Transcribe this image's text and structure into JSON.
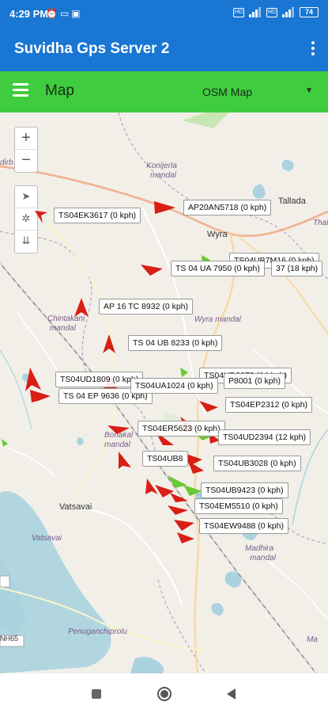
{
  "status": {
    "time": "4:29 PM",
    "left_icons": [
      "alarm-icon",
      "laptop-icon",
      "app-icon"
    ],
    "battery": "74",
    "hd1": "HD",
    "hd2": "HD"
  },
  "appbar": {
    "title": "Suvidha Gps Server 2",
    "menu_icon": "more-vert-icon"
  },
  "toolbar": {
    "label": "Map",
    "map_type": "OSM Map"
  },
  "map": {
    "zoom_in": "+",
    "zoom_out": "−",
    "places": [
      {
        "text": "Konijerla",
        "cls": "maplbl"
      },
      {
        "text": "mandal",
        "cls": "maplbl"
      },
      {
        "text": "Wyra",
        "cls": "townlbl"
      },
      {
        "text": "Wyra mandal",
        "cls": "maplbl"
      },
      {
        "text": "Chintakani",
        "cls": "maplbl"
      },
      {
        "text": "mandal",
        "cls": "maplbl"
      },
      {
        "text": "Bonakal",
        "cls": "maplbl"
      },
      {
        "text": "mandal",
        "cls": "maplbl"
      },
      {
        "text": "Vatsavai",
        "cls": "townlbl"
      },
      {
        "text": "Vatsavai",
        "cls": "maplbl"
      },
      {
        "text": "Madhira",
        "cls": "maplbl"
      },
      {
        "text": "mandal",
        "cls": "maplbl"
      },
      {
        "text": "Penuganchiprolu",
        "cls": "maplbl"
      },
      {
        "text": "Tallada",
        "cls": "townlbl"
      },
      {
        "text": "Thal",
        "cls": "maplbl"
      },
      {
        "text": "NH65",
        "cls": "townlbl"
      },
      {
        "text": "Ma",
        "cls": "maplbl"
      },
      {
        "text": "dirb",
        "cls": "maplbl"
      }
    ],
    "vehicles": [
      "AP20AN5718 (0 kph)",
      "TS04EK3617 (0 kph)",
      "TS04UB7M16 (0 kph)",
      "TS 04 UA 7950 (0 kph)",
      "37 (18 kph)",
      "AP 16 TC 8932 (0 kph)",
      "TS 04 UB 8233 (0 kph)",
      "TS04UD1809 (0 kph)",
      "TS04UD0073 (14 kph)",
      "TS 04 EP 9636 (0 kph)",
      "TS04UA1024 (0 kph)",
      "P8001 (0 kph)",
      "TS04EP2312 (0 kph)",
      "TS04ER5623 (0 kph)",
      "TS04UD2394 (12 kph)",
      "TS04UB8",
      "TS04UB3028 (0 kph)",
      "TS04UB9423 (0 kph)",
      "TS04EM5510 (0 kph)",
      "TS04EW9488 (0 kph)"
    ]
  }
}
